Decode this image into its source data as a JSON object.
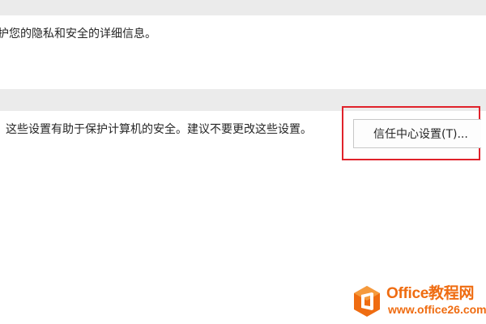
{
  "privacy_section": {
    "text": "护您的隐私和安全的详细信息。"
  },
  "trust_center_section": {
    "description": "这些设置有助于保护计算机的安全。建议不要更改这些设置。",
    "settings_button_label": "信任中心设置(T)..."
  },
  "watermark": {
    "name": "Office教程网",
    "url": "www.office26.com",
    "logo_icon": "office-logo-icon",
    "color": "#ef6c11"
  },
  "colors": {
    "band": "#ebebeb",
    "highlight": "#e0222b",
    "text": "#262626"
  }
}
